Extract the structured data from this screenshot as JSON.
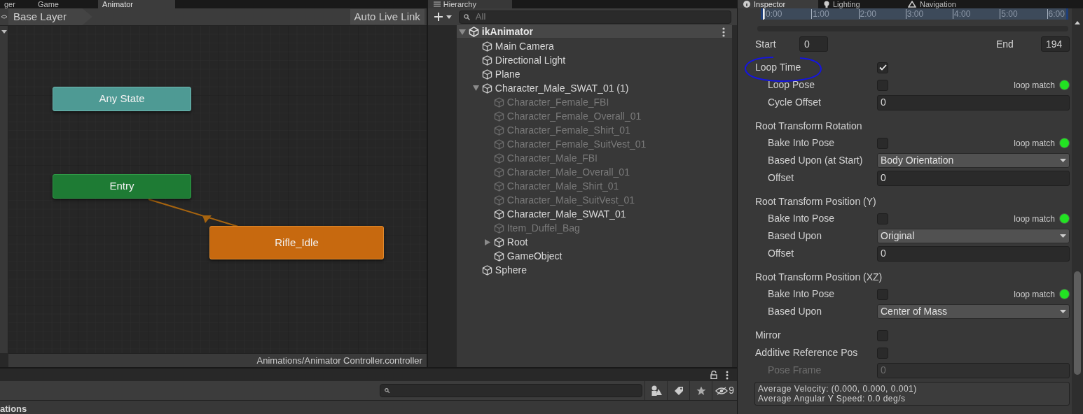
{
  "left_tabs": [
    {
      "label": "ger",
      "selected": false
    },
    {
      "label": "Game",
      "selected": false
    },
    {
      "label": "Animator",
      "selected": true
    }
  ],
  "animator": {
    "breadcrumb": "Base Layer",
    "live_link_button": "Auto Live Link",
    "path": "Animations/Animator Controller.controller",
    "nodes": [
      {
        "label": "Any State",
        "kind": "any"
      },
      {
        "label": "Entry",
        "kind": "entry"
      },
      {
        "label": "Rifle_Idle",
        "kind": "state"
      }
    ]
  },
  "hierarchy": {
    "tab": "Hierarchy",
    "search_placeholder": "All",
    "scene": "ikAnimator",
    "items": [
      {
        "name": "Main Camera",
        "disabled": false
      },
      {
        "name": "Directional Light",
        "disabled": false
      },
      {
        "name": "Plane",
        "disabled": false
      },
      {
        "name": "Character_Male_SWAT_01 (1)",
        "disabled": false,
        "expanded": true,
        "children": [
          {
            "name": "Character_Female_FBI",
            "disabled": true
          },
          {
            "name": "Character_Female_Overall_01",
            "disabled": true
          },
          {
            "name": "Character_Female_Shirt_01",
            "disabled": true
          },
          {
            "name": "Character_Female_SuitVest_01",
            "disabled": true
          },
          {
            "name": "Character_Male_FBI",
            "disabled": true
          },
          {
            "name": "Character_Male_Overall_01",
            "disabled": true
          },
          {
            "name": "Character_Male_Shirt_01",
            "disabled": true
          },
          {
            "name": "Character_Male_SuitVest_01",
            "disabled": true
          },
          {
            "name": "Character_Male_SWAT_01",
            "disabled": false
          },
          {
            "name": "Item_Duffel_Bag",
            "disabled": true
          },
          {
            "name": "Root",
            "disabled": false,
            "expanded": false
          },
          {
            "name": "GameObject",
            "disabled": false
          }
        ]
      },
      {
        "name": "Sphere",
        "disabled": false
      }
    ]
  },
  "inspector": {
    "tabs": [
      {
        "label": "Inspector",
        "selected": true
      },
      {
        "label": "Lighting",
        "selected": false
      },
      {
        "label": "Navigation",
        "selected": false
      }
    ],
    "timeline_labels": [
      "0:00",
      "1:00",
      "2:00",
      "3:00",
      "4:00",
      "5:00",
      "6:00"
    ],
    "start_label": "Start",
    "start": "0",
    "end_label": "End",
    "end": "194",
    "sections": [
      {
        "rows": [
          {
            "kind": "checkbox",
            "label": "Loop Time",
            "checked": true,
            "indent": false
          },
          {
            "kind": "checkbox",
            "label": "Loop Pose",
            "checked": false,
            "indent": true,
            "match": {
              "label": "loop match",
              "ok": true
            }
          },
          {
            "kind": "field",
            "label": "Cycle Offset",
            "value": "0",
            "indent": true,
            "disabled": false
          }
        ]
      },
      {
        "title": "Root Transform Rotation",
        "rows": [
          {
            "kind": "checkbox",
            "label": "Bake Into Pose",
            "checked": false,
            "indent": true,
            "match": {
              "label": "loop match",
              "ok": true
            }
          },
          {
            "kind": "dropdown",
            "label": "Based Upon (at Start)",
            "value": "Body Orientation",
            "indent": true
          },
          {
            "kind": "field",
            "label": "Offset",
            "value": "0",
            "indent": true,
            "disabled": false
          }
        ]
      },
      {
        "title": "Root Transform Position (Y)",
        "rows": [
          {
            "kind": "checkbox",
            "label": "Bake Into Pose",
            "checked": false,
            "indent": true,
            "match": {
              "label": "loop match",
              "ok": true
            }
          },
          {
            "kind": "dropdown",
            "label": "Based Upon",
            "value": "Original",
            "indent": true
          },
          {
            "kind": "field",
            "label": "Offset",
            "value": "0",
            "indent": true,
            "disabled": false
          }
        ]
      },
      {
        "title": "Root Transform Position (XZ)",
        "rows": [
          {
            "kind": "checkbox",
            "label": "Bake Into Pose",
            "checked": false,
            "indent": true,
            "match": {
              "label": "loop match",
              "ok": true
            }
          },
          {
            "kind": "dropdown",
            "label": "Based Upon",
            "value": "Center of Mass",
            "indent": true
          }
        ]
      },
      {
        "rows": [
          {
            "kind": "checkbox",
            "label": "Mirror",
            "checked": false,
            "indent": false
          },
          {
            "kind": "checkbox",
            "label": "Additive Reference Pos",
            "checked": false,
            "indent": false
          },
          {
            "kind": "field",
            "label": "Pose Frame",
            "value": "0",
            "indent": true,
            "disabled": true
          }
        ]
      }
    ],
    "info": [
      "Average Velocity: (0.000, 0.000, 0.001)",
      "Average Angular Y Speed: 0.0 deg/s"
    ]
  },
  "bottom": {
    "hidden_count": "9",
    "label": "ations"
  }
}
